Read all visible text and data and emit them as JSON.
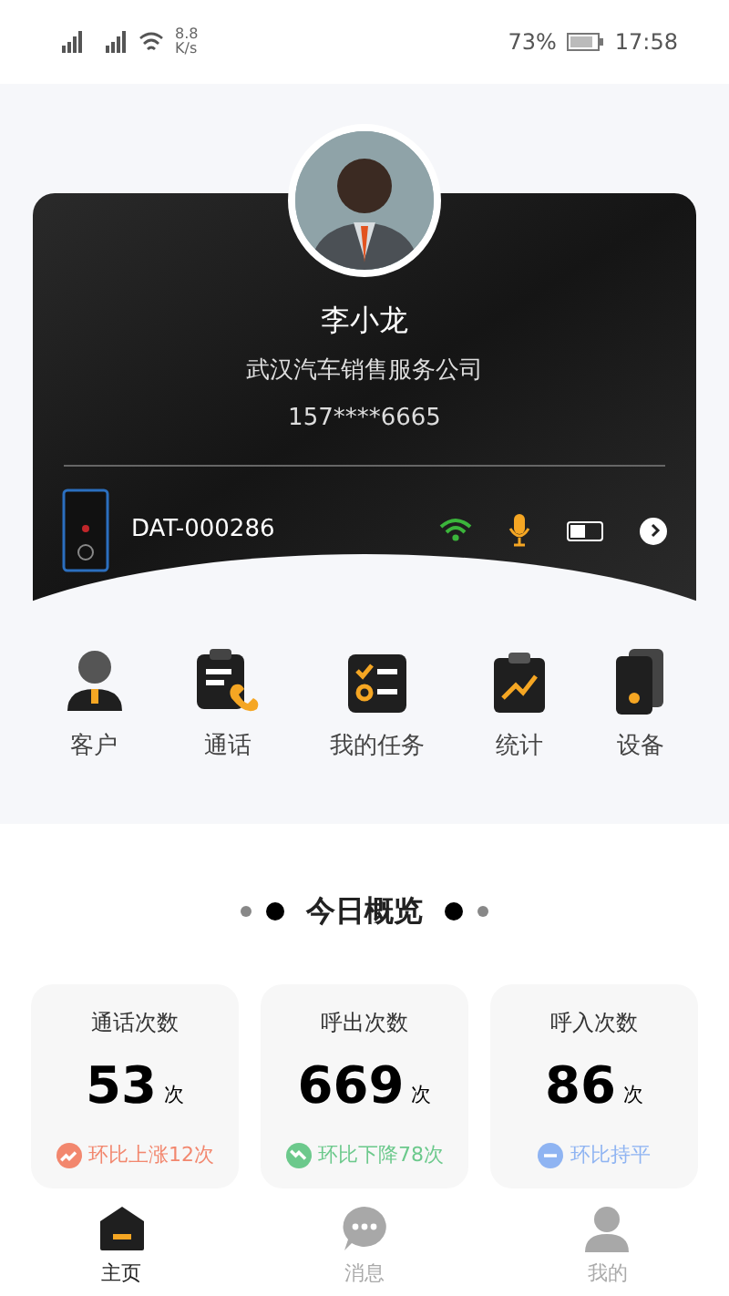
{
  "status_bar": {
    "network_speed": "8.8",
    "network_unit": "K/s",
    "battery": "73%",
    "time": "17:58"
  },
  "profile": {
    "name": "李小龙",
    "company": "武汉汽车销售服务公司",
    "phone": "157****6665"
  },
  "device": {
    "id": "DAT-000286",
    "wifi_on": true,
    "mic_on": true,
    "battery": {
      "level": 0.5
    }
  },
  "menu": [
    {
      "kind": "customer",
      "label": "客户"
    },
    {
      "kind": "call",
      "label": "通话"
    },
    {
      "kind": "tasks",
      "label": "我的任务"
    },
    {
      "kind": "stats",
      "label": "统计"
    },
    {
      "kind": "device",
      "label": "设备"
    }
  ],
  "overview": {
    "title": "今日概览",
    "cards": [
      {
        "label": "通话次数",
        "value": "53",
        "unit": "次",
        "kind": "up",
        "color": "#f2876e",
        "change": "环比上涨12次"
      },
      {
        "label": "呼出次数",
        "value": "669",
        "unit": "次",
        "kind": "down",
        "color": "#6cc98c",
        "change": "环比下降78次"
      },
      {
        "label": "呼入次数",
        "value": "86",
        "unit": "次",
        "kind": "flat",
        "color": "#8fb4f2",
        "change": "环比持平"
      }
    ]
  },
  "tab_bar": [
    {
      "kind": "home",
      "label": "主页",
      "selected": true
    },
    {
      "kind": "messages",
      "label": "消息",
      "selected": false
    },
    {
      "kind": "me",
      "label": "我的",
      "selected": false
    }
  ]
}
